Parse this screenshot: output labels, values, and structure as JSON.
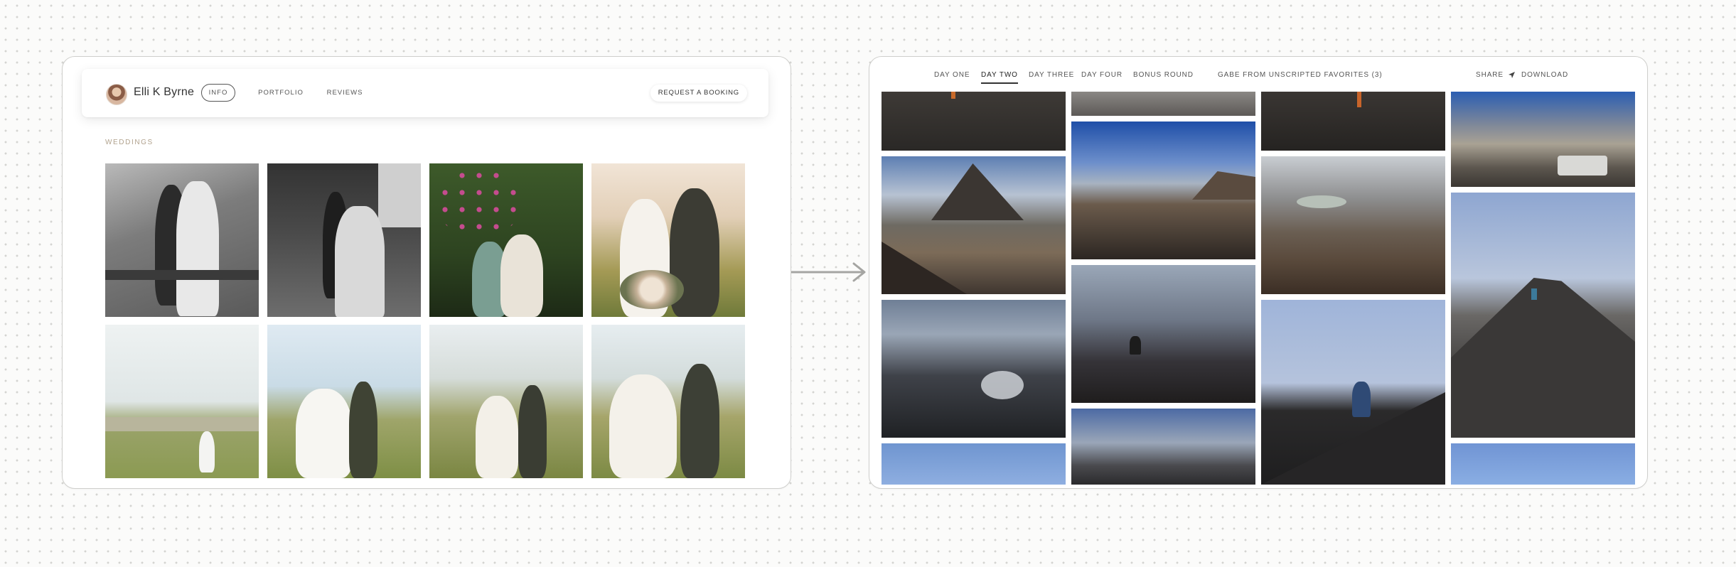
{
  "portfolio": {
    "profile_name": "Elli K Byrne",
    "avatar": "avatar",
    "nav": {
      "info": "INFO",
      "portfolio": "PORTFOLIO",
      "reviews": "REVIEWS"
    },
    "booking_label": "REQUEST A BOOKING",
    "section_label": "WEDDINGS"
  },
  "gallery": {
    "tabs": [
      "DAY ONE",
      "DAY TWO",
      "DAY THREE",
      "DAY FOUR",
      "BONUS ROUND"
    ],
    "active_tab": "DAY TWO",
    "favorites_label": "GABE FROM UNSCRIPTED FAVORITES (3)",
    "share_label": "SHARE",
    "share_icon": "send-icon",
    "download_label": "DOWNLOAD"
  },
  "transition_icon": "arrow-right-icon",
  "colors": {
    "accent_label": "#b1a28d",
    "sky": "#3b5fa0",
    "volcanic": "#2a2826"
  }
}
